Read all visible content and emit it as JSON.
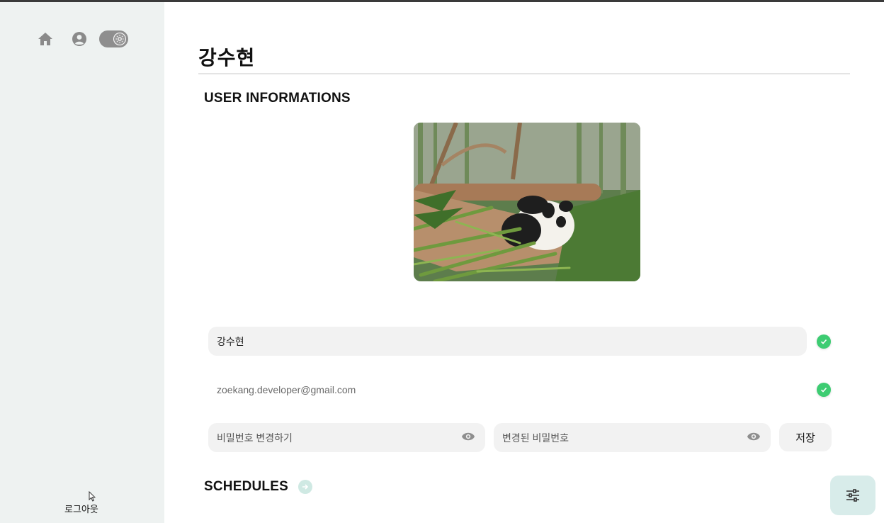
{
  "sidebar": {
    "home_icon": "home-icon",
    "profile_icon": "user-circle-icon",
    "theme_toggle_icon": "sun-icon",
    "logout_label": "로그아웃"
  },
  "header": {
    "page_title": "강수현"
  },
  "user_info": {
    "section_title": "USER INFORMATIONS",
    "name_value": "강수현",
    "email_value": "zoekang.developer@gmail.com",
    "password_placeholder": "비밀번호 변경하기",
    "new_password_placeholder": "변경된 비밀번호",
    "save_label": "저장"
  },
  "schedules": {
    "section_title": "SCHEDULES"
  },
  "colors": {
    "sidebar_bg": "#eef2f1",
    "check_green": "#3dcc72",
    "accent_mint": "#d8ecea"
  }
}
